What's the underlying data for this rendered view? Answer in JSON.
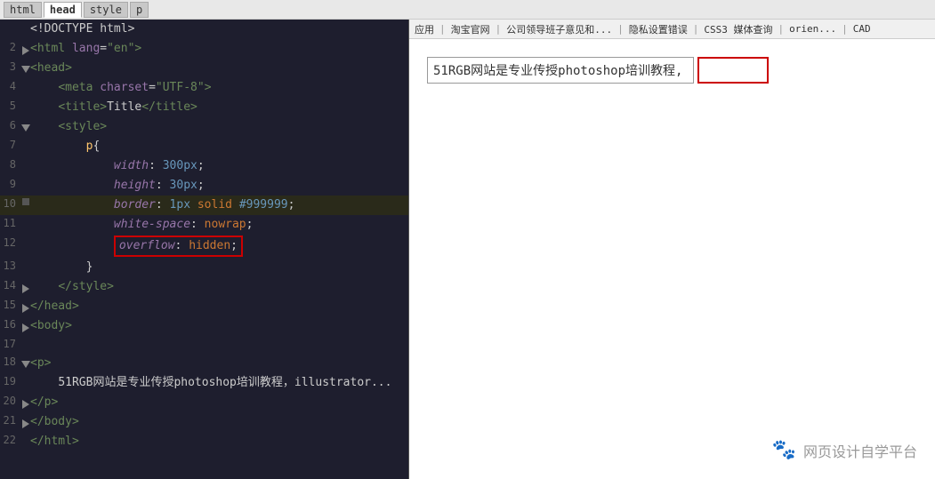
{
  "topbar": {
    "tabs": [
      "html",
      "head",
      "style",
      "p"
    ]
  },
  "browser_nav": {
    "items": [
      "应用",
      "淘宝官网",
      "公司领导班子意见和...",
      "隐私设置错误",
      "CSS3 媒体查询",
      "orien...",
      "CAD"
    ]
  },
  "code_lines": [
    {
      "num": "",
      "indent": "",
      "content": "<!DOCTYPE html>"
    },
    {
      "num": "2",
      "indent": "▶",
      "content": "<html lang=\"en\">"
    },
    {
      "num": "3",
      "indent": "▼",
      "content": "<head>"
    },
    {
      "num": "4",
      "indent": "",
      "content": "    <meta charset=\"UTF-8\">"
    },
    {
      "num": "5",
      "indent": "",
      "content": "    <title>Title</title>"
    },
    {
      "num": "6",
      "indent": "▼",
      "content": "    <style>"
    },
    {
      "num": "7",
      "indent": "",
      "content": "        p{"
    },
    {
      "num": "8",
      "indent": "",
      "content": "            width: 300px;"
    },
    {
      "num": "9",
      "indent": "",
      "content": "            height: 30px;"
    },
    {
      "num": "10",
      "indent": "■",
      "content": "            border: 1px solid #999999;"
    },
    {
      "num": "11",
      "indent": "",
      "content": "            white-space: nowrap;"
    },
    {
      "num": "12",
      "indent": "",
      "content": "            overflow: hidden;"
    },
    {
      "num": "13",
      "indent": "",
      "content": "        }"
    },
    {
      "num": "14",
      "indent": "▶",
      "content": "    </style>"
    },
    {
      "num": "15",
      "indent": "▶",
      "content": "</head>"
    },
    {
      "num": "16",
      "indent": "▶",
      "content": "<body>"
    },
    {
      "num": "17",
      "indent": "",
      "content": ""
    },
    {
      "num": "18",
      "indent": "▼",
      "content": "<p>"
    },
    {
      "num": "19",
      "indent": "",
      "content": "    51RGB网站是专业传授photoshop培训教程，illustrator..."
    },
    {
      "num": "20",
      "indent": "▶",
      "content": "</p>"
    },
    {
      "num": "21",
      "indent": "▶",
      "content": "</body>"
    },
    {
      "num": "22",
      "indent": "",
      "content": "</html>"
    }
  ],
  "preview": {
    "text": "51RGB网站是专业传授photoshop培训教程,",
    "watermark": "网页设计自学平台"
  }
}
